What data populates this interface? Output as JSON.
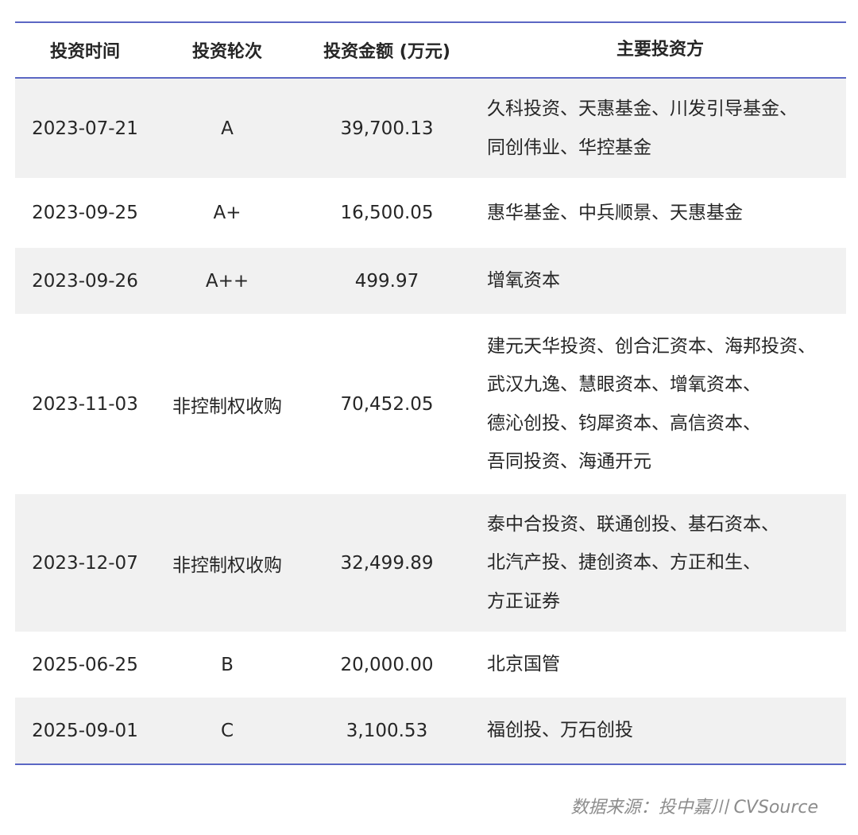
{
  "table": {
    "headers": {
      "date": "投资时间",
      "round": "投资轮次",
      "amount": "投资金额 (万元)",
      "investors": "主要投资方"
    },
    "rows": [
      {
        "date": "2023-07-21",
        "round": "A",
        "amount": "39,700.13",
        "investors": [
          "久科投资、天惠基金、川发引导基金、",
          "同创伟业、华控基金"
        ]
      },
      {
        "date": "2023-09-25",
        "round": "A+",
        "amount": "16,500.05",
        "investors": [
          "惠华基金、中兵顺景、天惠基金"
        ]
      },
      {
        "date": "2023-09-26",
        "round": "A++",
        "amount": "499.97",
        "investors": [
          "增氧资本"
        ]
      },
      {
        "date": "2023-11-03",
        "round": "非控制权收购",
        "amount": "70,452.05",
        "investors": [
          "建元天华投资、创合汇资本、海邦投资、",
          "武汉九逸、慧眼资本、增氧资本、",
          "德沁创投、钧犀资本、高信资本、",
          "吾同投资、海通开元"
        ]
      },
      {
        "date": "2023-12-07",
        "round": "非控制权收购",
        "amount": "32,499.89",
        "investors": [
          "泰中合投资、联通创投、基石资本、",
          "北汽产投、捷创资本、方正和生、",
          "方正证券"
        ]
      },
      {
        "date": "2025-06-25",
        "round": "B",
        "amount": "20,000.00",
        "investors": [
          "北京国管"
        ]
      },
      {
        "date": "2025-09-01",
        "round": "C",
        "amount": "3,100.53",
        "investors": [
          "福创投、万石创投"
        ]
      }
    ]
  },
  "source_note": "数据来源：投中嘉川 CVSource",
  "colors": {
    "rule": "#5b67c4",
    "shade": "#f1f1f1",
    "text": "#262626",
    "source": "#8c8c8c"
  }
}
